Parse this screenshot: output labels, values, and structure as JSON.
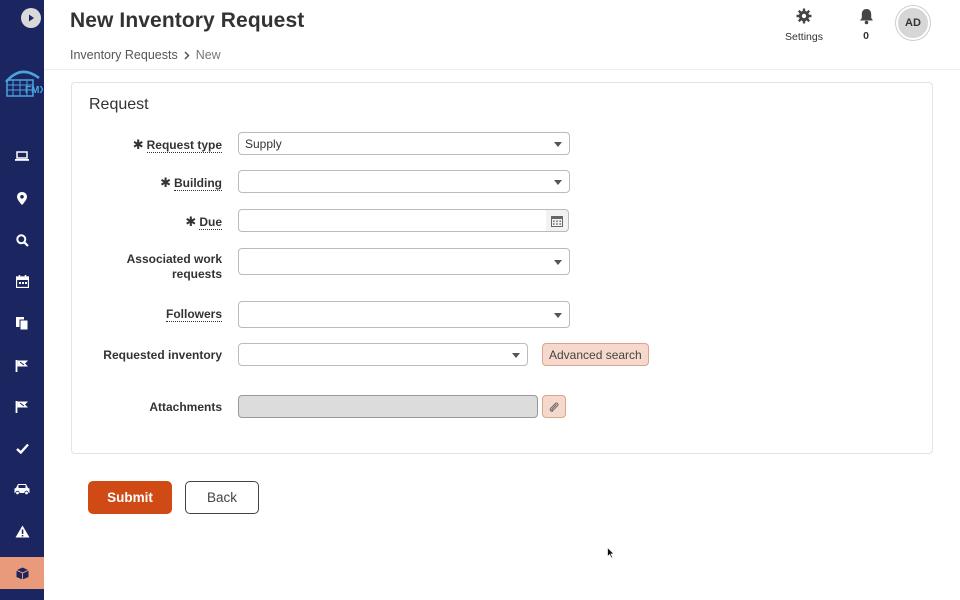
{
  "app": {
    "logo_text": "FMX"
  },
  "header": {
    "title": "New Inventory Request",
    "breadcrumb": {
      "parent": "Inventory Requests",
      "current": "New"
    },
    "settings_label": "Settings",
    "notifications_count": "0",
    "avatar_initials": "AD"
  },
  "sidebar": {
    "items": [
      {
        "icon": "laptop-icon"
      },
      {
        "icon": "map-pin-icon"
      },
      {
        "icon": "search-icon"
      },
      {
        "icon": "calendar-icon"
      },
      {
        "icon": "documents-icon"
      },
      {
        "icon": "flag-icon"
      },
      {
        "icon": "flag-icon"
      },
      {
        "icon": "checkmark-icon"
      },
      {
        "icon": "car-icon"
      },
      {
        "icon": "warning-icon"
      },
      {
        "icon": "box-icon",
        "active": true
      }
    ]
  },
  "form": {
    "section_title": "Request",
    "request_type": {
      "label": "Request type",
      "value": "Supply",
      "required": "✱"
    },
    "building": {
      "label": "Building",
      "value": "",
      "required": "✱"
    },
    "due": {
      "label": "Due",
      "value": "",
      "required": "✱"
    },
    "associated_work_requests": {
      "label": "Associated work requests",
      "value": ""
    },
    "followers": {
      "label": "Followers",
      "value": ""
    },
    "requested_inventory": {
      "label": "Requested inventory",
      "value": "",
      "advanced_search_label": "Advanced search"
    },
    "attachments": {
      "label": "Attachments"
    }
  },
  "actions": {
    "submit_label": "Submit",
    "back_label": "Back"
  },
  "colors": {
    "sidebar_bg": "#1b2560",
    "accent": "#cf4a14",
    "active_nav": "#e89a7a",
    "secondary_button_bg": "#f6d9cc"
  }
}
